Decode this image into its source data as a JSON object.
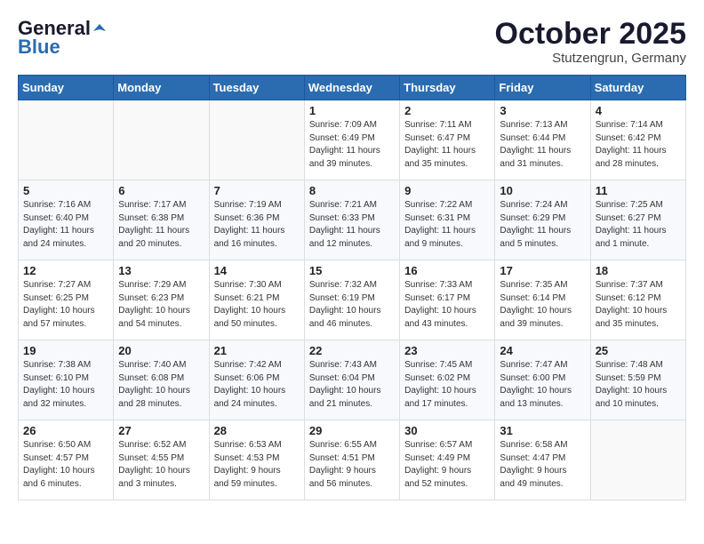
{
  "header": {
    "logo_line1": "General",
    "logo_line2": "Blue",
    "month": "October 2025",
    "location": "Stutzengrun, Germany"
  },
  "weekdays": [
    "Sunday",
    "Monday",
    "Tuesday",
    "Wednesday",
    "Thursday",
    "Friday",
    "Saturday"
  ],
  "weeks": [
    [
      {
        "day": "",
        "info": ""
      },
      {
        "day": "",
        "info": ""
      },
      {
        "day": "",
        "info": ""
      },
      {
        "day": "1",
        "info": "Sunrise: 7:09 AM\nSunset: 6:49 PM\nDaylight: 11 hours\nand 39 minutes."
      },
      {
        "day": "2",
        "info": "Sunrise: 7:11 AM\nSunset: 6:47 PM\nDaylight: 11 hours\nand 35 minutes."
      },
      {
        "day": "3",
        "info": "Sunrise: 7:13 AM\nSunset: 6:44 PM\nDaylight: 11 hours\nand 31 minutes."
      },
      {
        "day": "4",
        "info": "Sunrise: 7:14 AM\nSunset: 6:42 PM\nDaylight: 11 hours\nand 28 minutes."
      }
    ],
    [
      {
        "day": "5",
        "info": "Sunrise: 7:16 AM\nSunset: 6:40 PM\nDaylight: 11 hours\nand 24 minutes."
      },
      {
        "day": "6",
        "info": "Sunrise: 7:17 AM\nSunset: 6:38 PM\nDaylight: 11 hours\nand 20 minutes."
      },
      {
        "day": "7",
        "info": "Sunrise: 7:19 AM\nSunset: 6:36 PM\nDaylight: 11 hours\nand 16 minutes."
      },
      {
        "day": "8",
        "info": "Sunrise: 7:21 AM\nSunset: 6:33 PM\nDaylight: 11 hours\nand 12 minutes."
      },
      {
        "day": "9",
        "info": "Sunrise: 7:22 AM\nSunset: 6:31 PM\nDaylight: 11 hours\nand 9 minutes."
      },
      {
        "day": "10",
        "info": "Sunrise: 7:24 AM\nSunset: 6:29 PM\nDaylight: 11 hours\nand 5 minutes."
      },
      {
        "day": "11",
        "info": "Sunrise: 7:25 AM\nSunset: 6:27 PM\nDaylight: 11 hours\nand 1 minute."
      }
    ],
    [
      {
        "day": "12",
        "info": "Sunrise: 7:27 AM\nSunset: 6:25 PM\nDaylight: 10 hours\nand 57 minutes."
      },
      {
        "day": "13",
        "info": "Sunrise: 7:29 AM\nSunset: 6:23 PM\nDaylight: 10 hours\nand 54 minutes."
      },
      {
        "day": "14",
        "info": "Sunrise: 7:30 AM\nSunset: 6:21 PM\nDaylight: 10 hours\nand 50 minutes."
      },
      {
        "day": "15",
        "info": "Sunrise: 7:32 AM\nSunset: 6:19 PM\nDaylight: 10 hours\nand 46 minutes."
      },
      {
        "day": "16",
        "info": "Sunrise: 7:33 AM\nSunset: 6:17 PM\nDaylight: 10 hours\nand 43 minutes."
      },
      {
        "day": "17",
        "info": "Sunrise: 7:35 AM\nSunset: 6:14 PM\nDaylight: 10 hours\nand 39 minutes."
      },
      {
        "day": "18",
        "info": "Sunrise: 7:37 AM\nSunset: 6:12 PM\nDaylight: 10 hours\nand 35 minutes."
      }
    ],
    [
      {
        "day": "19",
        "info": "Sunrise: 7:38 AM\nSunset: 6:10 PM\nDaylight: 10 hours\nand 32 minutes."
      },
      {
        "day": "20",
        "info": "Sunrise: 7:40 AM\nSunset: 6:08 PM\nDaylight: 10 hours\nand 28 minutes."
      },
      {
        "day": "21",
        "info": "Sunrise: 7:42 AM\nSunset: 6:06 PM\nDaylight: 10 hours\nand 24 minutes."
      },
      {
        "day": "22",
        "info": "Sunrise: 7:43 AM\nSunset: 6:04 PM\nDaylight: 10 hours\nand 21 minutes."
      },
      {
        "day": "23",
        "info": "Sunrise: 7:45 AM\nSunset: 6:02 PM\nDaylight: 10 hours\nand 17 minutes."
      },
      {
        "day": "24",
        "info": "Sunrise: 7:47 AM\nSunset: 6:00 PM\nDaylight: 10 hours\nand 13 minutes."
      },
      {
        "day": "25",
        "info": "Sunrise: 7:48 AM\nSunset: 5:59 PM\nDaylight: 10 hours\nand 10 minutes."
      }
    ],
    [
      {
        "day": "26",
        "info": "Sunrise: 6:50 AM\nSunset: 4:57 PM\nDaylight: 10 hours\nand 6 minutes."
      },
      {
        "day": "27",
        "info": "Sunrise: 6:52 AM\nSunset: 4:55 PM\nDaylight: 10 hours\nand 3 minutes."
      },
      {
        "day": "28",
        "info": "Sunrise: 6:53 AM\nSunset: 4:53 PM\nDaylight: 9 hours\nand 59 minutes."
      },
      {
        "day": "29",
        "info": "Sunrise: 6:55 AM\nSunset: 4:51 PM\nDaylight: 9 hours\nand 56 minutes."
      },
      {
        "day": "30",
        "info": "Sunrise: 6:57 AM\nSunset: 4:49 PM\nDaylight: 9 hours\nand 52 minutes."
      },
      {
        "day": "31",
        "info": "Sunrise: 6:58 AM\nSunset: 4:47 PM\nDaylight: 9 hours\nand 49 minutes."
      },
      {
        "day": "",
        "info": ""
      }
    ]
  ]
}
